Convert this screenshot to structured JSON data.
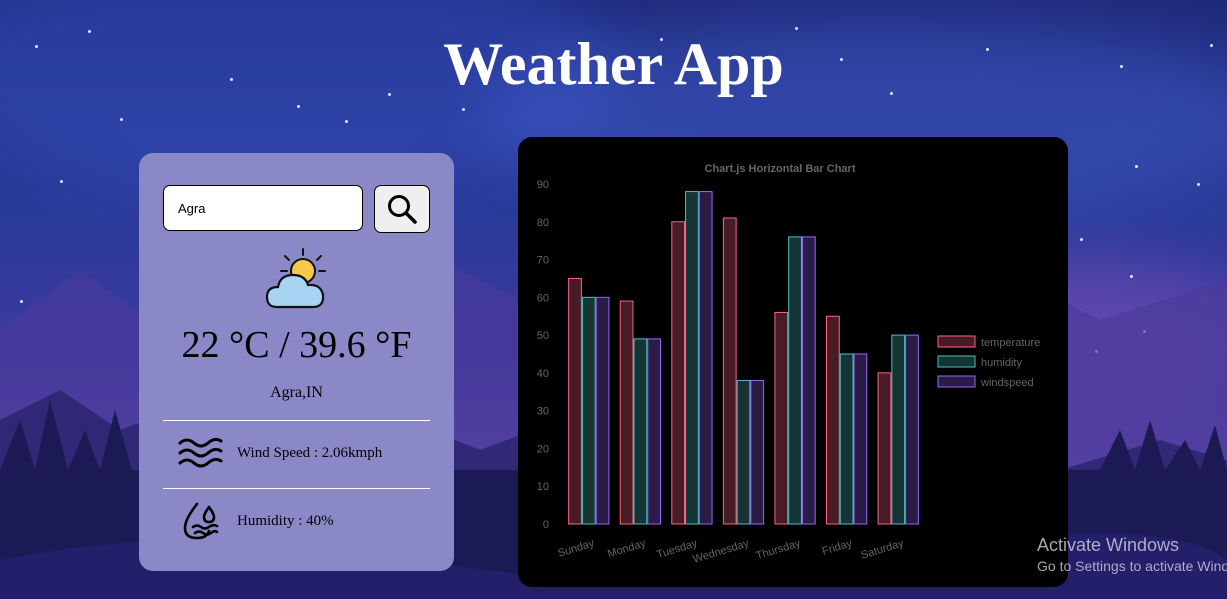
{
  "app": {
    "title": "Weather App"
  },
  "search": {
    "value": "Agra",
    "placeholder": "",
    "button_icon": "search-icon"
  },
  "weather": {
    "icon": "partly-cloudy-icon",
    "temperature_text": "22 °C / 39.6 °F",
    "location": "Agra,IN",
    "wind_label": "Wind Speed : 2.06kmph",
    "humidity_label": "Humidity : 40%"
  },
  "chart_data": {
    "type": "bar",
    "title": "Chart.js Horizontal Bar Chart",
    "categories": [
      "Sunday",
      "Monday",
      "Tuesday",
      "Wednesday",
      "Thursday",
      "Friday",
      "Saturday"
    ],
    "series": [
      {
        "name": "temperature",
        "values": [
          65,
          59,
          80,
          81,
          56,
          55,
          40
        ],
        "color": "#ff6384"
      },
      {
        "name": "humidity",
        "values": [
          60,
          49,
          88,
          38,
          76,
          45,
          50
        ],
        "color": "#4bc0c0"
      },
      {
        "name": "windspeed",
        "values": [
          60,
          49,
          88,
          38,
          76,
          45,
          50
        ],
        "color": "#9966ff"
      }
    ],
    "ylim": [
      0,
      90
    ],
    "yticks": [
      0,
      10,
      20,
      30,
      40,
      50,
      60,
      70,
      80,
      90
    ],
    "xlabel": "",
    "ylabel": "",
    "legend_position": "right",
    "grid": false
  },
  "colors": {
    "card_background": "#8b88c8",
    "chart_background": "#000000",
    "title_color": "#ffffff"
  },
  "system_overlay": {
    "line1": "Activate Windows",
    "line2": "Go to Settings to activate Windows."
  }
}
